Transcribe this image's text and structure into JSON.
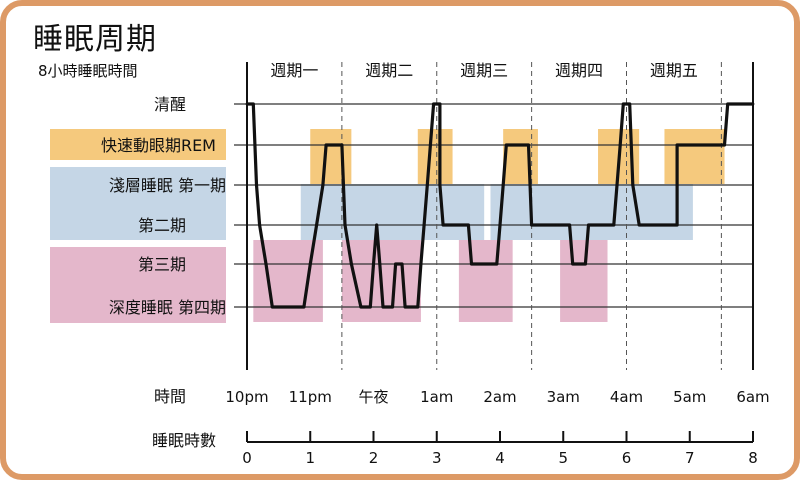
{
  "title": "睡眠周期",
  "subtitle": "8小時睡眠時間",
  "colors": {
    "border": "#dd9a66",
    "rem": "#f5c97d",
    "light": "#c5d6e6",
    "deep": "#e4b7cb",
    "line": "#111111"
  },
  "chart_data": {
    "type": "line",
    "title": "睡眠周期",
    "subtitle": "8小時睡眠時間",
    "stages": [
      {
        "key": "awake",
        "label": "清醒"
      },
      {
        "key": "rem",
        "label": "快速動眼期REM"
      },
      {
        "key": "n1",
        "label": "淺層睡眠 第一期"
      },
      {
        "key": "n2",
        "label": "第二期"
      },
      {
        "key": "n3",
        "label": "第三期"
      },
      {
        "key": "n4",
        "label": "深度睡眠 第四期"
      }
    ],
    "cycles": [
      "週期一",
      "週期二",
      "週期三",
      "週期四",
      "週期五"
    ],
    "cycle_boundaries": [
      1.5,
      3.0,
      4.5,
      6.0,
      7.5
    ],
    "time_axis_label": "時間",
    "time_ticks": [
      {
        "x": 0,
        "label": "10pm"
      },
      {
        "x": 1,
        "label": "11pm"
      },
      {
        "x": 2,
        "label": "午夜"
      },
      {
        "x": 3,
        "label": "1am"
      },
      {
        "x": 4,
        "label": "2am"
      },
      {
        "x": 5,
        "label": "3am"
      },
      {
        "x": 6,
        "label": "4am"
      },
      {
        "x": 7,
        "label": "5am"
      },
      {
        "x": 8,
        "label": "6am"
      }
    ],
    "hours_axis_label": "睡眠時數",
    "hours_ticks": [
      "0",
      "1",
      "2",
      "3",
      "4",
      "5",
      "6",
      "7",
      "8"
    ],
    "xlim": [
      0,
      8
    ],
    "series": [
      {
        "values": [
          [
            0.0,
            "awake"
          ],
          [
            0.1,
            "awake"
          ],
          [
            0.15,
            "n1"
          ],
          [
            0.2,
            "n2"
          ],
          [
            0.3,
            "n3"
          ],
          [
            0.4,
            "n4"
          ],
          [
            0.9,
            "n4"
          ],
          [
            1.0,
            "n3"
          ],
          [
            1.1,
            "n2"
          ],
          [
            1.2,
            "n1"
          ],
          [
            1.25,
            "rem"
          ],
          [
            1.5,
            "rem"
          ],
          [
            1.55,
            "n2"
          ],
          [
            1.65,
            "n3"
          ],
          [
            1.8,
            "n4"
          ],
          [
            1.95,
            "n4"
          ],
          [
            2.0,
            "n3"
          ],
          [
            2.05,
            "n2"
          ],
          [
            2.1,
            "n3"
          ],
          [
            2.15,
            "n4"
          ],
          [
            2.3,
            "n4"
          ],
          [
            2.35,
            "n3"
          ],
          [
            2.45,
            "n3"
          ],
          [
            2.5,
            "n4"
          ],
          [
            2.7,
            "n4"
          ],
          [
            2.75,
            "n3"
          ],
          [
            2.8,
            "n2"
          ],
          [
            2.85,
            "n1"
          ],
          [
            2.9,
            "rem"
          ],
          [
            2.95,
            "awake"
          ],
          [
            3.05,
            "awake"
          ],
          [
            3.05,
            "n1"
          ],
          [
            3.1,
            "n2"
          ],
          [
            3.5,
            "n2"
          ],
          [
            3.55,
            "n3"
          ],
          [
            3.95,
            "n3"
          ],
          [
            4.0,
            "n2"
          ],
          [
            4.05,
            "n1"
          ],
          [
            4.1,
            "rem"
          ],
          [
            4.45,
            "rem"
          ],
          [
            4.5,
            "n2"
          ],
          [
            4.9,
            "n2"
          ],
          [
            5.1,
            "n2"
          ],
          [
            5.15,
            "n3"
          ],
          [
            5.35,
            "n3"
          ],
          [
            5.4,
            "n2"
          ],
          [
            5.8,
            "n2"
          ],
          [
            5.85,
            "n1"
          ],
          [
            5.9,
            "rem"
          ],
          [
            5.95,
            "awake"
          ],
          [
            6.05,
            "awake"
          ],
          [
            6.1,
            "n1"
          ],
          [
            6.2,
            "n2"
          ],
          [
            6.8,
            "n2"
          ],
          [
            6.8,
            "rem"
          ],
          [
            7.55,
            "rem"
          ],
          [
            7.6,
            "awake"
          ],
          [
            8.0,
            "awake"
          ]
        ]
      }
    ],
    "highlight_boxes": [
      {
        "stage": "rem",
        "x0": 1.0,
        "x1": 1.65
      },
      {
        "stage": "rem",
        "x0": 2.7,
        "x1": 3.25
      },
      {
        "stage": "rem",
        "x0": 4.05,
        "x1": 4.6
      },
      {
        "stage": "rem",
        "x0": 5.55,
        "x1": 6.2
      },
      {
        "stage": "rem",
        "x0": 6.6,
        "x1": 7.55
      },
      {
        "stage": "light",
        "x0": 0.85,
        "x1": 3.75
      },
      {
        "stage": "light",
        "x0": 3.85,
        "x1": 7.05
      },
      {
        "stage": "deep",
        "x0": 0.1,
        "x1": 1.2
      },
      {
        "stage": "deep",
        "x0": 1.5,
        "x1": 2.75
      },
      {
        "stage": "deep",
        "x0": 3.35,
        "x1": 4.2
      },
      {
        "stage": "deep",
        "x0": 4.95,
        "x1": 5.7
      }
    ]
  }
}
